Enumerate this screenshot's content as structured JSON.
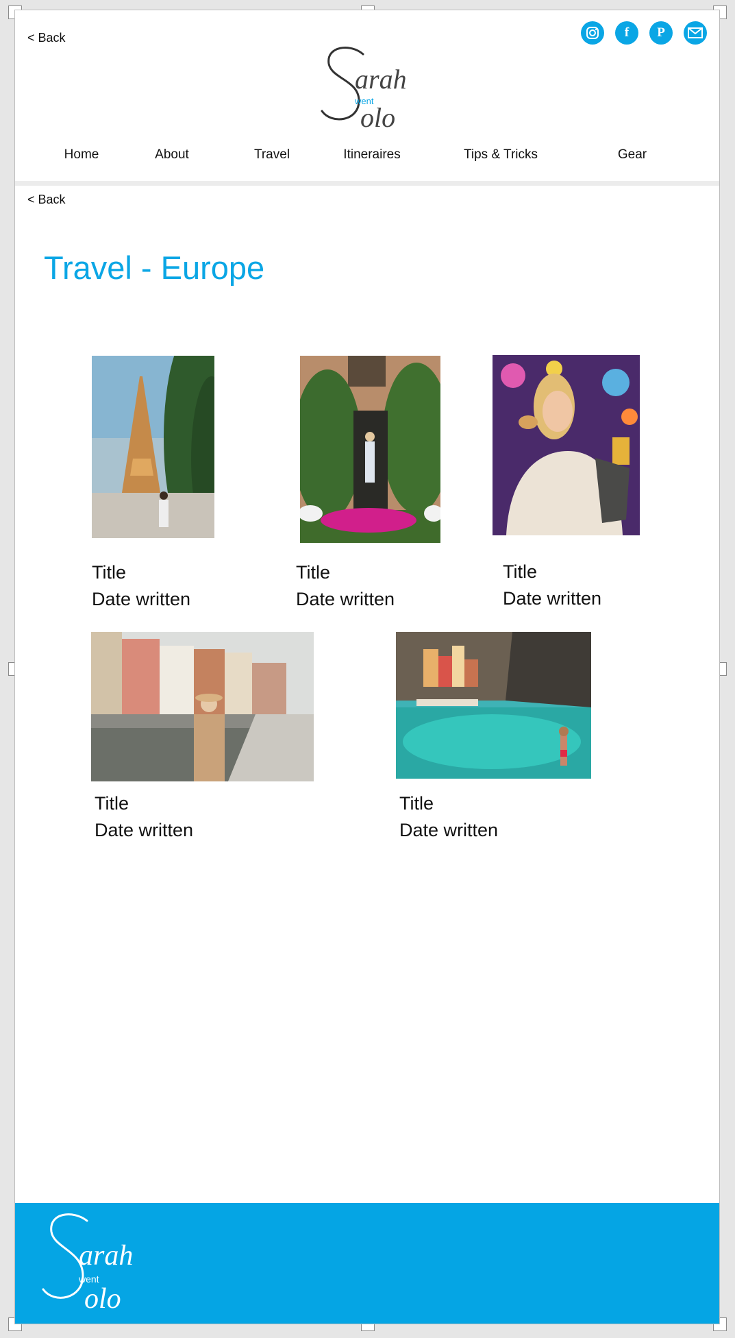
{
  "header": {
    "back_label": "< Back",
    "social_icons": [
      "instagram-icon",
      "facebook-icon",
      "pinterest-icon",
      "mail-icon"
    ],
    "logo_text": {
      "first": "arah",
      "middle": "went",
      "last": "olo"
    }
  },
  "nav": {
    "items": [
      {
        "label": "Home"
      },
      {
        "label": "About"
      },
      {
        "label": "Travel"
      },
      {
        "label": "Itineraires"
      },
      {
        "label": "Tips & Tricks"
      },
      {
        "label": "Gear"
      }
    ]
  },
  "content": {
    "back_label": "< Back",
    "page_title": "Travel - Europe",
    "cards": [
      {
        "title": "Title",
        "date": "Date written",
        "photo": "eiffel-tower-photo"
      },
      {
        "title": "Title",
        "date": "Date written",
        "photo": "ivy-doorway-photo"
      },
      {
        "title": "Title",
        "date": "Date written",
        "photo": "fair-snack-photo"
      },
      {
        "title": "Title",
        "date": "Date written",
        "photo": "canal-town-photo"
      },
      {
        "title": "Title",
        "date": "Date written",
        "photo": "coastal-village-photo"
      }
    ]
  },
  "colors": {
    "accent": "#0aa6e5",
    "footer": "#05a5e4"
  }
}
